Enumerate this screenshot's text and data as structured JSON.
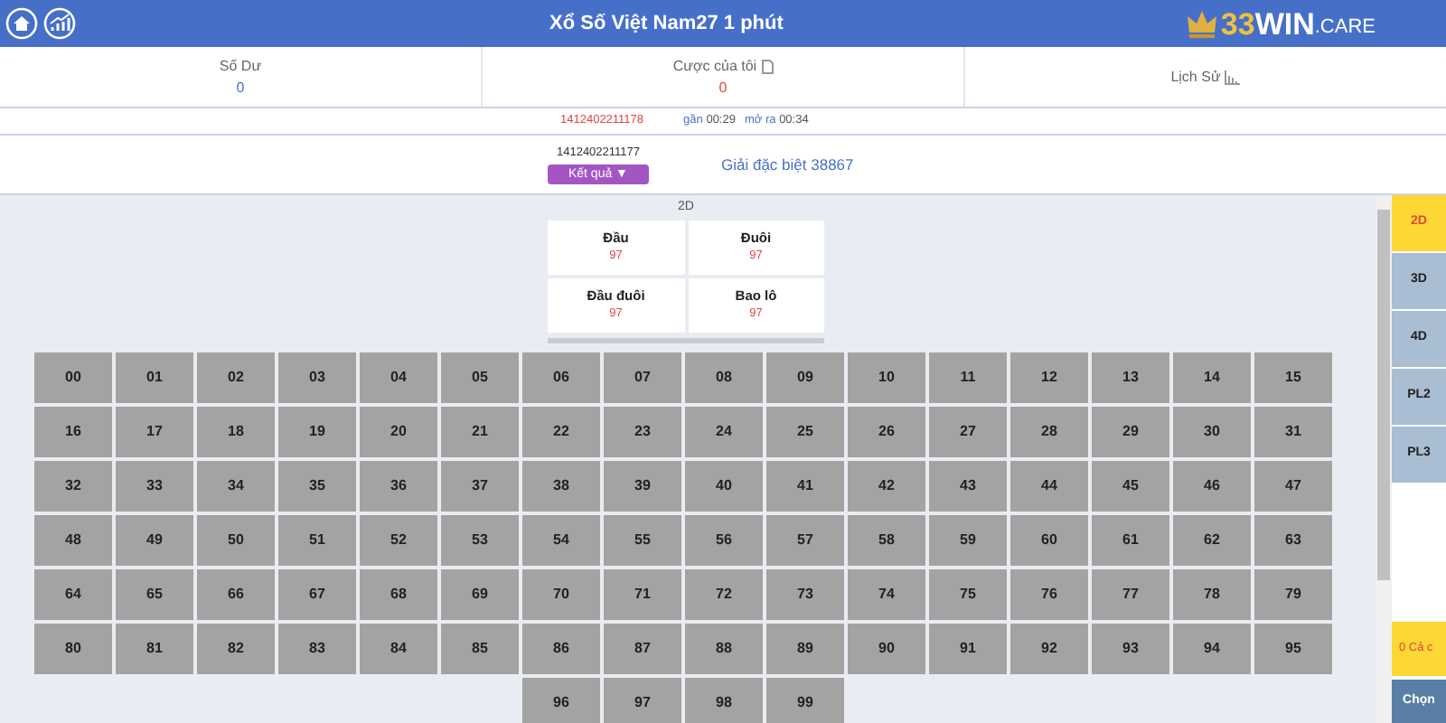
{
  "header": {
    "title": "Xổ Số Việt Nam27 1 phút",
    "logo": {
      "main": "33WIN",
      "suffix": ".CARE"
    }
  },
  "stats": [
    {
      "label": "Số Dư",
      "value": "0",
      "kind": "plain"
    },
    {
      "label": "Cược của tôi",
      "value": "0",
      "kind": "bets"
    },
    {
      "label": "Lịch Sử",
      "kind": "history"
    }
  ],
  "current": {
    "issue": "1412402211178",
    "countdown_label": "gần",
    "countdown": "00:29",
    "open_label": "mở ra",
    "open_time": "00:34"
  },
  "previous": {
    "issue": "1412402211177",
    "result_button": "Kết quả ▼",
    "prize": "Giải đặc biệt 38867"
  },
  "mode_label": "2D",
  "bet_types": [
    {
      "name": "Đầu",
      "odds": "97"
    },
    {
      "name": "Đuôi",
      "odds": "97"
    },
    {
      "name": "Đầu đuôi",
      "odds": "97"
    },
    {
      "name": "Bao lô",
      "odds": "97"
    }
  ],
  "numbers": [
    "00",
    "01",
    "02",
    "03",
    "04",
    "05",
    "06",
    "07",
    "08",
    "09",
    "10",
    "11",
    "12",
    "13",
    "14",
    "15",
    "16",
    "17",
    "18",
    "19",
    "20",
    "21",
    "22",
    "23",
    "24",
    "25",
    "26",
    "27",
    "28",
    "29",
    "30",
    "31",
    "32",
    "33",
    "34",
    "35",
    "36",
    "37",
    "38",
    "39",
    "40",
    "41",
    "42",
    "43",
    "44",
    "45",
    "46",
    "47",
    "48",
    "49",
    "50",
    "51",
    "52",
    "53",
    "54",
    "55",
    "56",
    "57",
    "58",
    "59",
    "60",
    "61",
    "62",
    "63",
    "64",
    "65",
    "66",
    "67",
    "68",
    "69",
    "70",
    "71",
    "72",
    "73",
    "74",
    "75",
    "76",
    "77",
    "78",
    "79",
    "80",
    "81",
    "82",
    "83",
    "84",
    "85",
    "86",
    "87",
    "88",
    "89",
    "90",
    "91",
    "92",
    "93",
    "94",
    "95",
    "96",
    "97",
    "98",
    "99"
  ],
  "side_tabs": [
    {
      "label": "2D",
      "selected": true
    },
    {
      "label": "3D",
      "selected": false
    },
    {
      "label": "4D",
      "selected": false
    },
    {
      "label": "PL2",
      "selected": false
    },
    {
      "label": "PL3",
      "selected": false
    }
  ],
  "selection_count": "0 Cả c",
  "choose_button": "Chọn"
}
